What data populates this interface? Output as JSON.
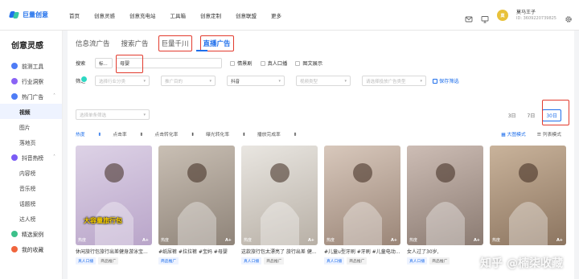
{
  "brand": {
    "name": "巨量创意"
  },
  "topnav": [
    "首页",
    "创意灵感",
    "创意充电站",
    "工具箱",
    "创意定制",
    "创意联盟",
    "更多"
  ],
  "user": {
    "name": "莫马王子",
    "id": "ID: 3609220739825"
  },
  "sidebar": {
    "title": "创意灵感",
    "items": [
      {
        "label": "前测工具",
        "icon": "flask-icon",
        "color": "#4e7cf6",
        "level": 0
      },
      {
        "label": "行业洞察",
        "icon": "insight-icon",
        "color": "#8a63f5",
        "level": 0
      },
      {
        "label": "热门广告",
        "icon": "hot-icon",
        "color": "#4e7cf6",
        "level": 0,
        "expandable": true
      },
      {
        "label": "视频",
        "level": 1,
        "active": true
      },
      {
        "label": "图片",
        "level": 1
      },
      {
        "label": "落地页",
        "level": 1
      },
      {
        "label": "抖音热榜",
        "icon": "douyin-icon",
        "color": "#7b5cf5",
        "level": 0,
        "expandable": true
      },
      {
        "label": "内容榜",
        "level": 1
      },
      {
        "label": "音乐榜",
        "level": 1
      },
      {
        "label": "话题榜",
        "level": 1
      },
      {
        "label": "达人榜",
        "level": 1
      },
      {
        "label": "精选案例",
        "icon": "case-icon",
        "color": "#3cc08a",
        "level": 0
      },
      {
        "label": "我的收藏",
        "icon": "star-icon",
        "color": "#f0653d",
        "level": 0
      }
    ]
  },
  "tabs": [
    "信息流广告",
    "搜索广告",
    "巨量千川",
    "直播广告"
  ],
  "search": {
    "label": "搜索",
    "scope": "标...",
    "value": "母婴",
    "checkboxes": [
      "情景剧",
      "真人口播",
      "图文展示"
    ]
  },
  "filters": {
    "label": "筛选",
    "selects": [
      "选择行业分类",
      "推广目的",
      "抖音",
      "视频类型",
      "请选择投放广告类型"
    ],
    "save": "保存筛选"
  },
  "extra_select": "选择单条筛选",
  "date_range": {
    "options": [
      "3日",
      "7日",
      "30日"
    ],
    "active": "30日"
  },
  "sort": [
    "热度",
    "点击率",
    "点击转化率",
    "曝光转化率",
    "播放完成率"
  ],
  "view_modes": [
    "大图模式",
    "列表模式"
  ],
  "cards": [
    {
      "title": "休闲旅行包旅行出差健身游泳宝...",
      "tags": [
        "真人口播",
        "商品推广"
      ],
      "badge": "热度",
      "ai": "A+",
      "overlay": "大容量旅行包",
      "c1": "#ddd2e6",
      "c2": "#b9a5c9"
    },
    {
      "title": "#纸尿裤 #拉拉裤 #宝妈 #母婴",
      "tags": [
        "商品推广"
      ],
      "badge": "热度",
      "ai": "A+",
      "overlay": "",
      "c1": "#c9bfb4",
      "c2": "#8f8479"
    },
    {
      "title": "这款旅行包太漂亮了 旅行出差 健...",
      "tags": [
        "真人口播",
        "商品推广"
      ],
      "badge": "热度",
      "ai": "A+",
      "overlay": "",
      "c1": "#e9e6e1",
      "c2": "#b8b0a6"
    },
    {
      "title": "#儿童u型牙刷 #牙刷 #儿童电动...",
      "tags": [
        "真人口播",
        "商品推广"
      ],
      "badge": "热度",
      "ai": "A+",
      "overlay": "",
      "c1": "#d8c8bc",
      "c2": "#9b8678"
    },
    {
      "title": "女人过了30岁,",
      "tags": [
        "真人口播",
        "商品推广"
      ],
      "badge": "热度",
      "ai": "A+",
      "overlay": "",
      "c1": "#cdbdb5",
      "c2": "#8b7b72"
    },
    {
      "title": "",
      "tags": [],
      "badge": "热度",
      "ai": "A+",
      "overlay": "",
      "c1": "#c9b39b",
      "c2": "#8c7560"
    }
  ],
  "watermark": "知乎 @楠柒收藏",
  "accent": "#1f6feb",
  "highlight": "#e23b2e"
}
